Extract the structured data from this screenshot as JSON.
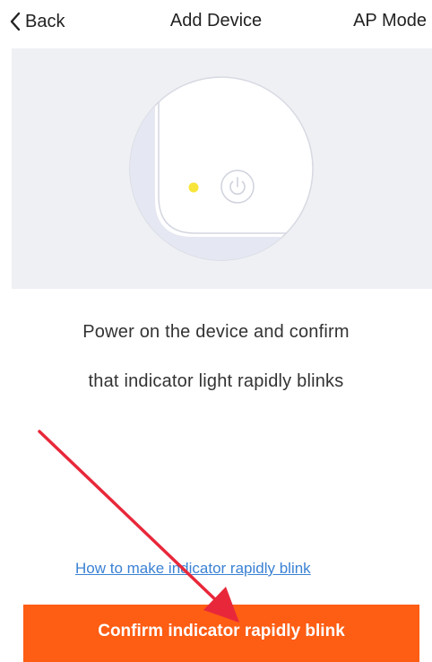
{
  "header": {
    "back_label": "Back",
    "title": "Add Device",
    "ap_mode_label": "AP Mode"
  },
  "illustration": {
    "background_color": "#eff0f4",
    "indicator_color": "#f8e53a",
    "icons": [
      "power-icon",
      "indicator-light"
    ]
  },
  "instruction": {
    "line1": "Power on the device and confirm",
    "line2": "that indicator light rapidly blinks"
  },
  "help_link": {
    "label": "How to make indicator rapidly blink"
  },
  "confirm_button": {
    "label": "Confirm indicator rapidly blink",
    "color": "#fe5d14"
  },
  "annotation": {
    "arrow_color": "#e8283a"
  }
}
